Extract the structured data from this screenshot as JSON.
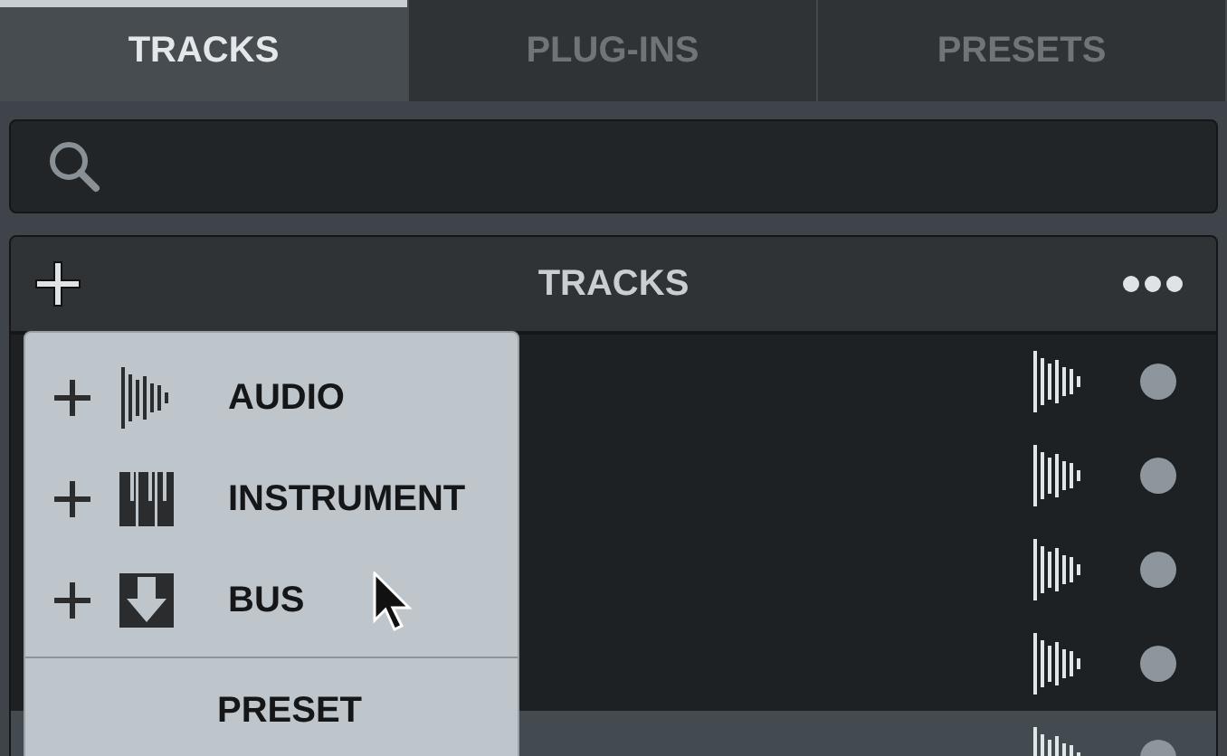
{
  "tabs": [
    {
      "label": "TRACKS",
      "selected": true
    },
    {
      "label": "PLUG-INS",
      "selected": false
    },
    {
      "label": "PRESETS",
      "selected": false
    }
  ],
  "tracks_panel": {
    "title": "TRACKS",
    "rows": [
      {
        "selected": false
      },
      {
        "selected": false
      },
      {
        "selected": false
      },
      {
        "selected": false
      },
      {
        "selected": true
      }
    ]
  },
  "add_menu": {
    "items": [
      {
        "kind": "audio",
        "label": "AUDIO"
      },
      {
        "kind": "instrument",
        "label": "INSTRUMENT"
      },
      {
        "kind": "bus",
        "label": "BUS"
      },
      {
        "kind": "preset",
        "label": "PRESET"
      }
    ]
  }
}
